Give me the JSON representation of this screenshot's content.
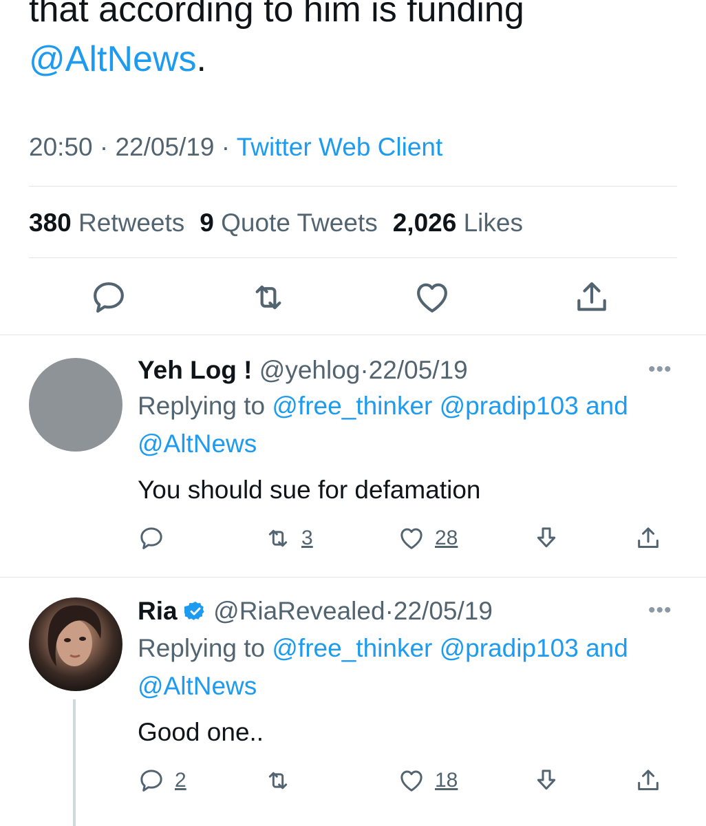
{
  "main_tweet": {
    "text_line1": "that according to him is funding",
    "mention": "@AltNews",
    "text_end": ".",
    "time": "20:50",
    "date": "22/05/19",
    "client": "Twitter Web Client",
    "retweets_count": "380",
    "retweets_label": "Retweets",
    "quotes_count": "9",
    "quotes_label": "Quote Tweets",
    "likes_count": "2,026",
    "likes_label": "Likes"
  },
  "replies": [
    {
      "name": "Yeh Log !",
      "handle": "@yehlog",
      "date": "22/05/19",
      "replying_label": "Replying to",
      "replying_to_1": "@free_thinker",
      "replying_to_2": "@pradip103",
      "replying_and": "and",
      "replying_to_3": "@AltNews",
      "text": "You should sue for defamation",
      "reply_count": "",
      "retweet_count": "3",
      "like_count": "28",
      "more": "•••"
    },
    {
      "name": "Ria",
      "handle": "@RiaRevealed",
      "date": "22/05/19",
      "verified": true,
      "replying_label": "Replying to",
      "replying_to_1": "@free_thinker",
      "replying_to_2": "@pradip103",
      "replying_and": "and",
      "replying_to_3": "@AltNews",
      "text": "Good one..",
      "reply_count": "2",
      "retweet_count": "",
      "like_count": "18",
      "more": "•••"
    }
  ],
  "separator": "·",
  "colors": {
    "link": "#1d9bf0",
    "muted": "#536471",
    "text": "#0f1419",
    "divider": "#e1e4e8",
    "verified": "#1d9bf0"
  },
  "icons": [
    "reply-icon",
    "retweet-icon",
    "like-icon",
    "share-icon",
    "bookmark-down-icon",
    "more-icon",
    "verified-icon"
  ]
}
